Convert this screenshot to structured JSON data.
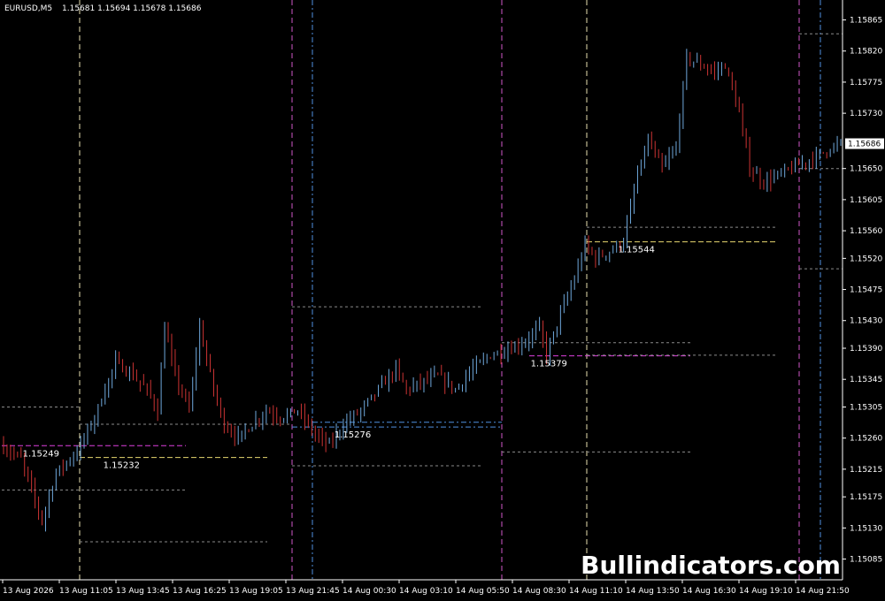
{
  "header": {
    "symbol": "EURUSD,M5",
    "ohlc": "1.15681 1.15694 1.15678 1.15686"
  },
  "watermark": "Bullindicators.com",
  "colors": {
    "background": "#000000",
    "bull": "#6fa8dc",
    "bear": "#cc3333",
    "axis": "#ffffff",
    "vline_pink": "#d058c8",
    "vline_cream": "#e8e0b0",
    "vline_blue": "#4f8fe0",
    "level_gray": "#8a8a8a",
    "level_pink": "#e040e0",
    "level_yellow": "#e8d870",
    "level_blue": "#4f8fe0"
  },
  "chart_data": {
    "type": "candlestick",
    "symbol": "EURUSD",
    "timeframe": "M5",
    "current_price": "1.15686",
    "ylim": [
      1.15055,
      1.1589
    ],
    "y_ticks": [
      "1.15865",
      "1.15820",
      "1.15775",
      "1.15730",
      "1.15686",
      "1.15650",
      "1.15605",
      "1.15560",
      "1.15520",
      "1.15475",
      "1.15430",
      "1.15390",
      "1.15345",
      "1.15305",
      "1.15260",
      "1.15215",
      "1.15175",
      "1.15130",
      "1.15085"
    ],
    "x_ticks": [
      "13 Aug 2026",
      "13 Aug 11:05",
      "13 Aug 13:45",
      "13 Aug 16:25",
      "13 Aug 19:05",
      "13 Aug 21:45",
      "14 Aug 00:30",
      "14 Aug 03:10",
      "14 Aug 05:50",
      "14 Aug 08:30",
      "14 Aug 11:10",
      "14 Aug 13:50",
      "14 Aug 16:30",
      "14 Aug 19:10",
      "14 Aug 21:50"
    ],
    "price_path": [
      {
        "x": 0,
        "y": 1.1525
      },
      {
        "x": 6,
        "y": 1.1523
      },
      {
        "x": 12,
        "y": 1.1514
      },
      {
        "x": 16,
        "y": 1.1521
      },
      {
        "x": 22,
        "y": 1.1524
      },
      {
        "x": 27,
        "y": 1.1529
      },
      {
        "x": 33,
        "y": 1.1537
      },
      {
        "x": 38,
        "y": 1.1535
      },
      {
        "x": 42,
        "y": 1.1533
      },
      {
        "x": 45,
        "y": 1.153
      },
      {
        "x": 47,
        "y": 1.1542
      },
      {
        "x": 50,
        "y": 1.1535
      },
      {
        "x": 54,
        "y": 1.153
      },
      {
        "x": 57,
        "y": 1.1542
      },
      {
        "x": 61,
        "y": 1.1533
      },
      {
        "x": 64,
        "y": 1.1528
      },
      {
        "x": 68,
        "y": 1.1526
      },
      {
        "x": 72,
        "y": 1.1528
      },
      {
        "x": 76,
        "y": 1.153
      },
      {
        "x": 80,
        "y": 1.1529
      },
      {
        "x": 85,
        "y": 1.153
      },
      {
        "x": 90,
        "y": 1.15265
      },
      {
        "x": 94,
        "y": 1.1525
      },
      {
        "x": 98,
        "y": 1.1528
      },
      {
        "x": 103,
        "y": 1.153
      },
      {
        "x": 108,
        "y": 1.1533
      },
      {
        "x": 113,
        "y": 1.1536
      },
      {
        "x": 116,
        "y": 1.1533
      },
      {
        "x": 120,
        "y": 1.1534
      },
      {
        "x": 125,
        "y": 1.1535
      },
      {
        "x": 130,
        "y": 1.1533
      },
      {
        "x": 135,
        "y": 1.1536
      },
      {
        "x": 140,
        "y": 1.1538
      },
      {
        "x": 146,
        "y": 1.1539
      },
      {
        "x": 150,
        "y": 1.154
      },
      {
        "x": 154,
        "y": 1.1542
      },
      {
        "x": 156,
        "y": 1.1538
      },
      {
        "x": 160,
        "y": 1.1544
      },
      {
        "x": 164,
        "y": 1.1549
      },
      {
        "x": 167,
        "y": 1.1554
      },
      {
        "x": 170,
        "y": 1.1552
      },
      {
        "x": 174,
        "y": 1.1553
      },
      {
        "x": 178,
        "y": 1.15545
      },
      {
        "x": 182,
        "y": 1.1564
      },
      {
        "x": 185,
        "y": 1.1569
      },
      {
        "x": 189,
        "y": 1.1565
      },
      {
        "x": 193,
        "y": 1.1568
      },
      {
        "x": 196,
        "y": 1.1581
      },
      {
        "x": 200,
        "y": 1.158
      },
      {
        "x": 204,
        "y": 1.1579
      },
      {
        "x": 207,
        "y": 1.158
      },
      {
        "x": 211,
        "y": 1.1573
      },
      {
        "x": 214,
        "y": 1.1565
      },
      {
        "x": 218,
        "y": 1.1563
      },
      {
        "x": 222,
        "y": 1.1564
      },
      {
        "x": 226,
        "y": 1.1565
      },
      {
        "x": 230,
        "y": 1.1566
      },
      {
        "x": 234,
        "y": 1.1567
      },
      {
        "x": 237,
        "y": 1.1568
      },
      {
        "x": 240,
        "y": 1.15686
      }
    ],
    "price_labels": [
      {
        "text": "1.15249",
        "x": 9,
        "y": 1.15249
      },
      {
        "text": "1.15232",
        "x": 32,
        "y": 1.15232
      },
      {
        "text": "1.15276",
        "x": 98,
        "y": 1.15276
      },
      {
        "text": "1.15379",
        "x": 154,
        "y": 1.15379
      },
      {
        "text": "1.15544",
        "x": 179,
        "y": 1.15544
      }
    ]
  }
}
